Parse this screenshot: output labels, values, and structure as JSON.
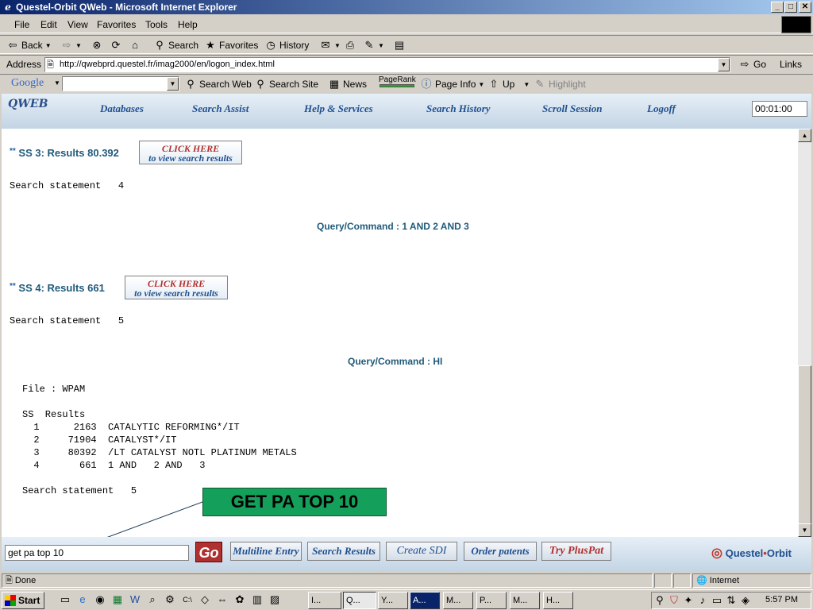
{
  "window": {
    "title": "Questel-Orbit QWeb - Microsoft Internet Explorer"
  },
  "menu": [
    "File",
    "Edit",
    "View",
    "Favorites",
    "Tools",
    "Help"
  ],
  "toolbar": {
    "back": "Back",
    "search": "Search",
    "favorites": "Favorites",
    "history": "History"
  },
  "address": {
    "label": "Address",
    "url": "http://qwebprd.questel.fr/imag2000/en/logon_index.html",
    "go": "Go",
    "links": "Links"
  },
  "google": {
    "logo": "Google",
    "search_web": "Search Web",
    "search_site": "Search Site",
    "news": "News",
    "pagerank": "PageRank",
    "page_info": "Page Info",
    "up": "Up",
    "highlight": "Highlight"
  },
  "qweb": {
    "logo": "QWEB",
    "nav": [
      "Databases",
      "Search Assist",
      "Help & Services",
      "Search History",
      "Scroll Session",
      "Logoff"
    ],
    "timer": "00:01:00"
  },
  "results": {
    "ss3": {
      "label": "SS 3: Results 80.392",
      "click_line1": "CLICK HERE",
      "click_line2": "to view search results",
      "statement": "Search statement   4",
      "query": "Query/Command : 1 AND 2 AND 3"
    },
    "ss4": {
      "label": "SS 4: Results 661",
      "click_line1": "CLICK HERE",
      "click_line2": "to view search results",
      "statement": "Search statement   5",
      "query": "Query/Command : HI"
    },
    "file_line": "File : WPAM",
    "history_header": "SS  Results",
    "history_rows": [
      "  1      2163  CATALYTIC REFORMING*/IT",
      "  2     71904  CATALYST*/IT",
      "  3     80392  /LT CATALYST NOTL PLATINUM METALS",
      "  4       661  1 AND   2 AND   3"
    ],
    "final_statement": "Search statement   5"
  },
  "callout": "GET PA TOP 10",
  "command": {
    "value": "get pa top 10",
    "go": "Go"
  },
  "bottom_buttons": [
    "Multiline Entry",
    "Search Results",
    "Create SDI",
    "Order patents",
    "Try PlusPat"
  ],
  "brand": {
    "name1": "Questel",
    "sep": "•",
    "name2": "Orbit"
  },
  "status": {
    "text": "Done",
    "zone": "Internet"
  },
  "taskbar": {
    "start": "Start",
    "tasks": [
      "I...",
      "Q...",
      "Y...",
      "A...",
      "M...",
      "P...",
      "M...",
      "H..."
    ],
    "clock": "5:57 PM"
  }
}
